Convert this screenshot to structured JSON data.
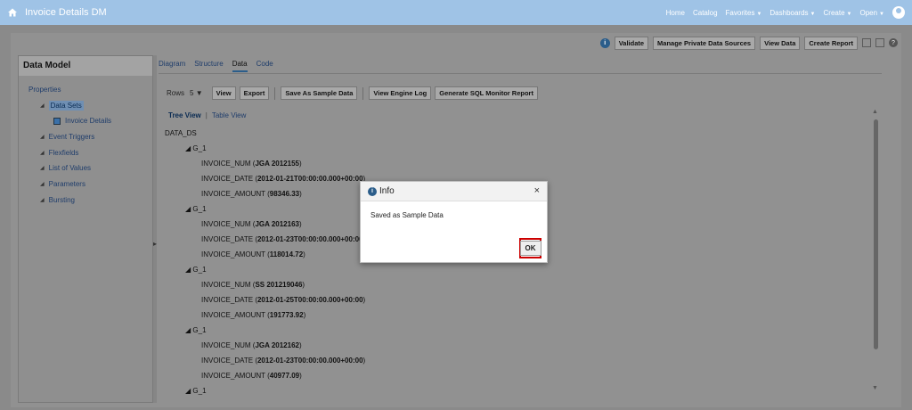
{
  "header": {
    "title": "Invoice Details DM",
    "nav": [
      "Home",
      "Catalog",
      "Favorites",
      "Dashboards",
      "Create",
      "Open"
    ]
  },
  "toolbar": {
    "validate": "Validate",
    "manage_private": "Manage Private Data Sources",
    "view_data": "View Data",
    "create_report": "Create Report"
  },
  "sidebar": {
    "title": "Data Model",
    "properties": "Properties",
    "data_sets": "Data Sets",
    "invoice_details": "Invoice Details",
    "items": [
      "Event Triggers",
      "Flexfields",
      "List of Values",
      "Parameters",
      "Bursting"
    ]
  },
  "tabs": [
    "Diagram",
    "Structure",
    "Data",
    "Code"
  ],
  "data_toolbar": {
    "rows_label": "Rows",
    "rows_value": "5",
    "view": "View",
    "export": "Export",
    "save_sample": "Save As Sample Data",
    "engine_log": "View Engine Log",
    "sql_monitor": "Generate SQL Monitor Report"
  },
  "views": {
    "tree": "Tree View",
    "table": "Table View",
    "separator": "|"
  },
  "tree": {
    "root": "DATA_DS",
    "group_label": "G_1",
    "groups": [
      {
        "num": "JGA 2012155",
        "date": "2012-01-21T00:00:00.000+00:00",
        "amount": "98346.33"
      },
      {
        "num": "JGA 2012163",
        "date": "2012-01-23T00:00:00.000+00:00",
        "amount": "118014.72"
      },
      {
        "num": "SS 201219046",
        "date": "2012-01-25T00:00:00.000+00:00",
        "amount": "191773.92"
      },
      {
        "num": "JGA 2012162",
        "date": "2012-01-23T00:00:00.000+00:00",
        "amount": "40977.09"
      }
    ],
    "fields": {
      "num": "INVOICE_NUM",
      "date": "INVOICE_DATE",
      "amount": "INVOICE_AMOUNT"
    }
  },
  "dialog": {
    "title": "Info",
    "message": "Saved as Sample Data",
    "ok": "OK",
    "close": "×"
  }
}
